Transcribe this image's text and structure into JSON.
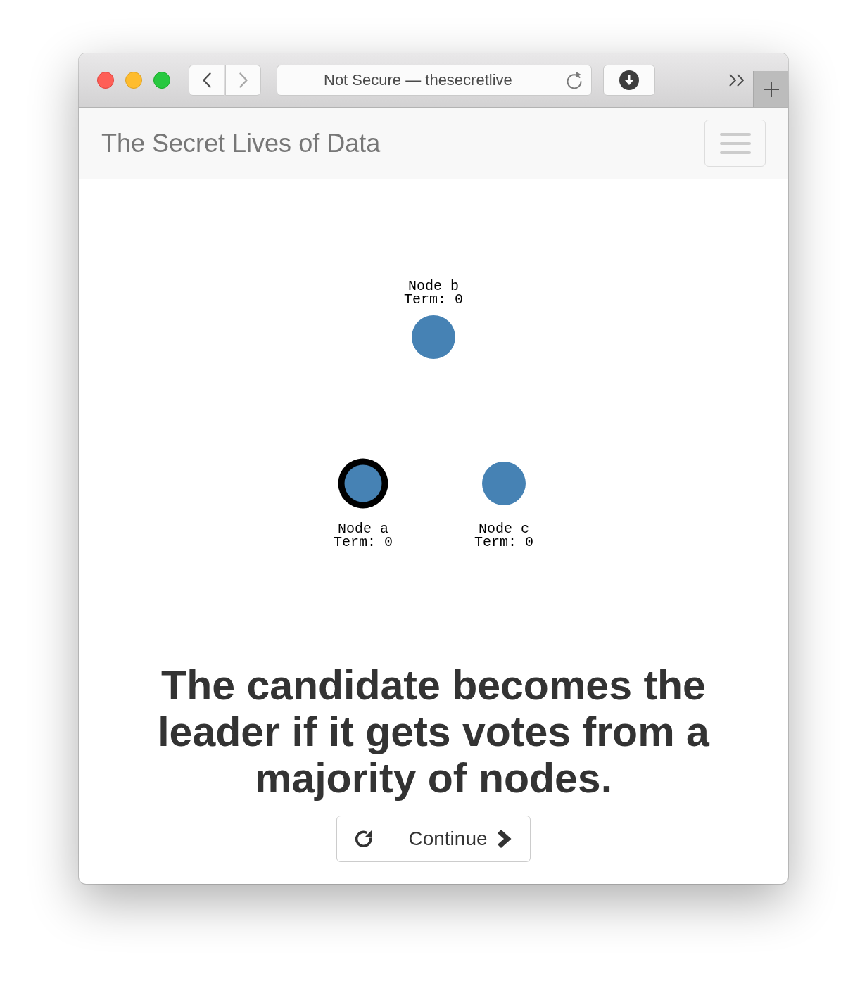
{
  "browser": {
    "back_enabled": true,
    "forward_enabled": false,
    "address": "Not Secure — thesecretlive"
  },
  "navbar": {
    "brand": "The Secret Lives of Data"
  },
  "diagram": {
    "nodes": [
      {
        "name": "Node b",
        "term": "Term: 0",
        "outlined": false
      },
      {
        "name": "Node a",
        "term": "Term: 0",
        "outlined": true
      },
      {
        "name": "Node c",
        "term": "Term: 0",
        "outlined": false
      }
    ]
  },
  "caption": "The candidate becomes the leader if it gets votes from a majority of nodes.",
  "controls": {
    "continue_label": "Continue"
  }
}
